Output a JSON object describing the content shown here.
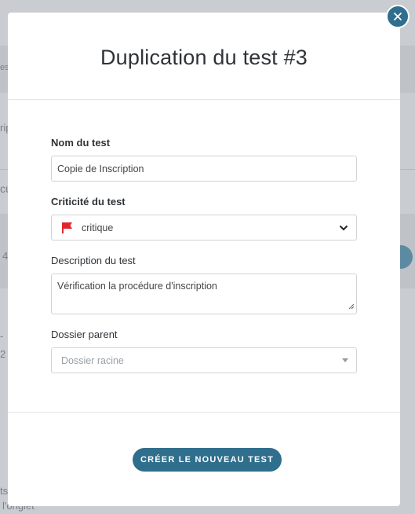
{
  "background": {
    "fragments": [
      "es",
      "rip",
      "cu",
      "4",
      "-",
      "2",
      "ts",
      "l'onglet"
    ]
  },
  "modal": {
    "title": "Duplication du test #3",
    "close_icon": "close-icon",
    "fields": {
      "name": {
        "label": "Nom du test",
        "value": "Copie de Inscription"
      },
      "criticality": {
        "label": "Criticité du test",
        "value": "critique",
        "flag_color": "#e0262b"
      },
      "description": {
        "label": "Description du test",
        "value": "Vérification la procédure d'inscription"
      },
      "parent": {
        "label": "Dossier parent",
        "placeholder": "Dossier racine"
      }
    },
    "submit_label": "CRÉER LE NOUVEAU TEST"
  },
  "colors": {
    "accent": "#2f6e8c",
    "flag": "#e0262b"
  }
}
